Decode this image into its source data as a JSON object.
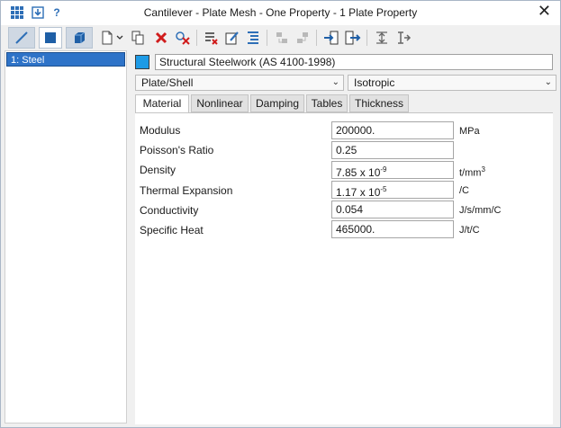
{
  "window": {
    "title": "Cantilever - Plate Mesh - One Property - 1 Plate Property",
    "close_glyph": "✕"
  },
  "list": {
    "items": [
      {
        "label": "1: Steel",
        "selected": true
      }
    ]
  },
  "material": {
    "color": "#1e9be6",
    "name": "Structural Steelwork (AS 4100-1998)"
  },
  "type_dropdown": {
    "value": "Plate/Shell"
  },
  "model_dropdown": {
    "value": "Isotropic"
  },
  "tabs": [
    {
      "label": "Material",
      "active": true
    },
    {
      "label": "Nonlinear",
      "active": false
    },
    {
      "label": "Damping",
      "active": false
    },
    {
      "label": "Tables",
      "active": false
    },
    {
      "label": "Thickness",
      "active": false
    }
  ],
  "properties": [
    {
      "label": "Modulus",
      "value": "200000.",
      "unit": "MPa"
    },
    {
      "label": "Poisson's Ratio",
      "value": "0.25",
      "unit": ""
    },
    {
      "label": "Density",
      "value": "7.85 x 10",
      "value_exp": "-9",
      "unit": "t/mm",
      "unit_exp": "3"
    },
    {
      "label": "Thermal Expansion",
      "value": "1.17 x 10",
      "value_exp": "-5",
      "unit": "/C"
    },
    {
      "label": "Conductivity",
      "value": "0.054",
      "unit": "J/s/mm/C"
    },
    {
      "label": "Specific Heat",
      "value": "465000.",
      "unit": "J/t/C"
    }
  ]
}
